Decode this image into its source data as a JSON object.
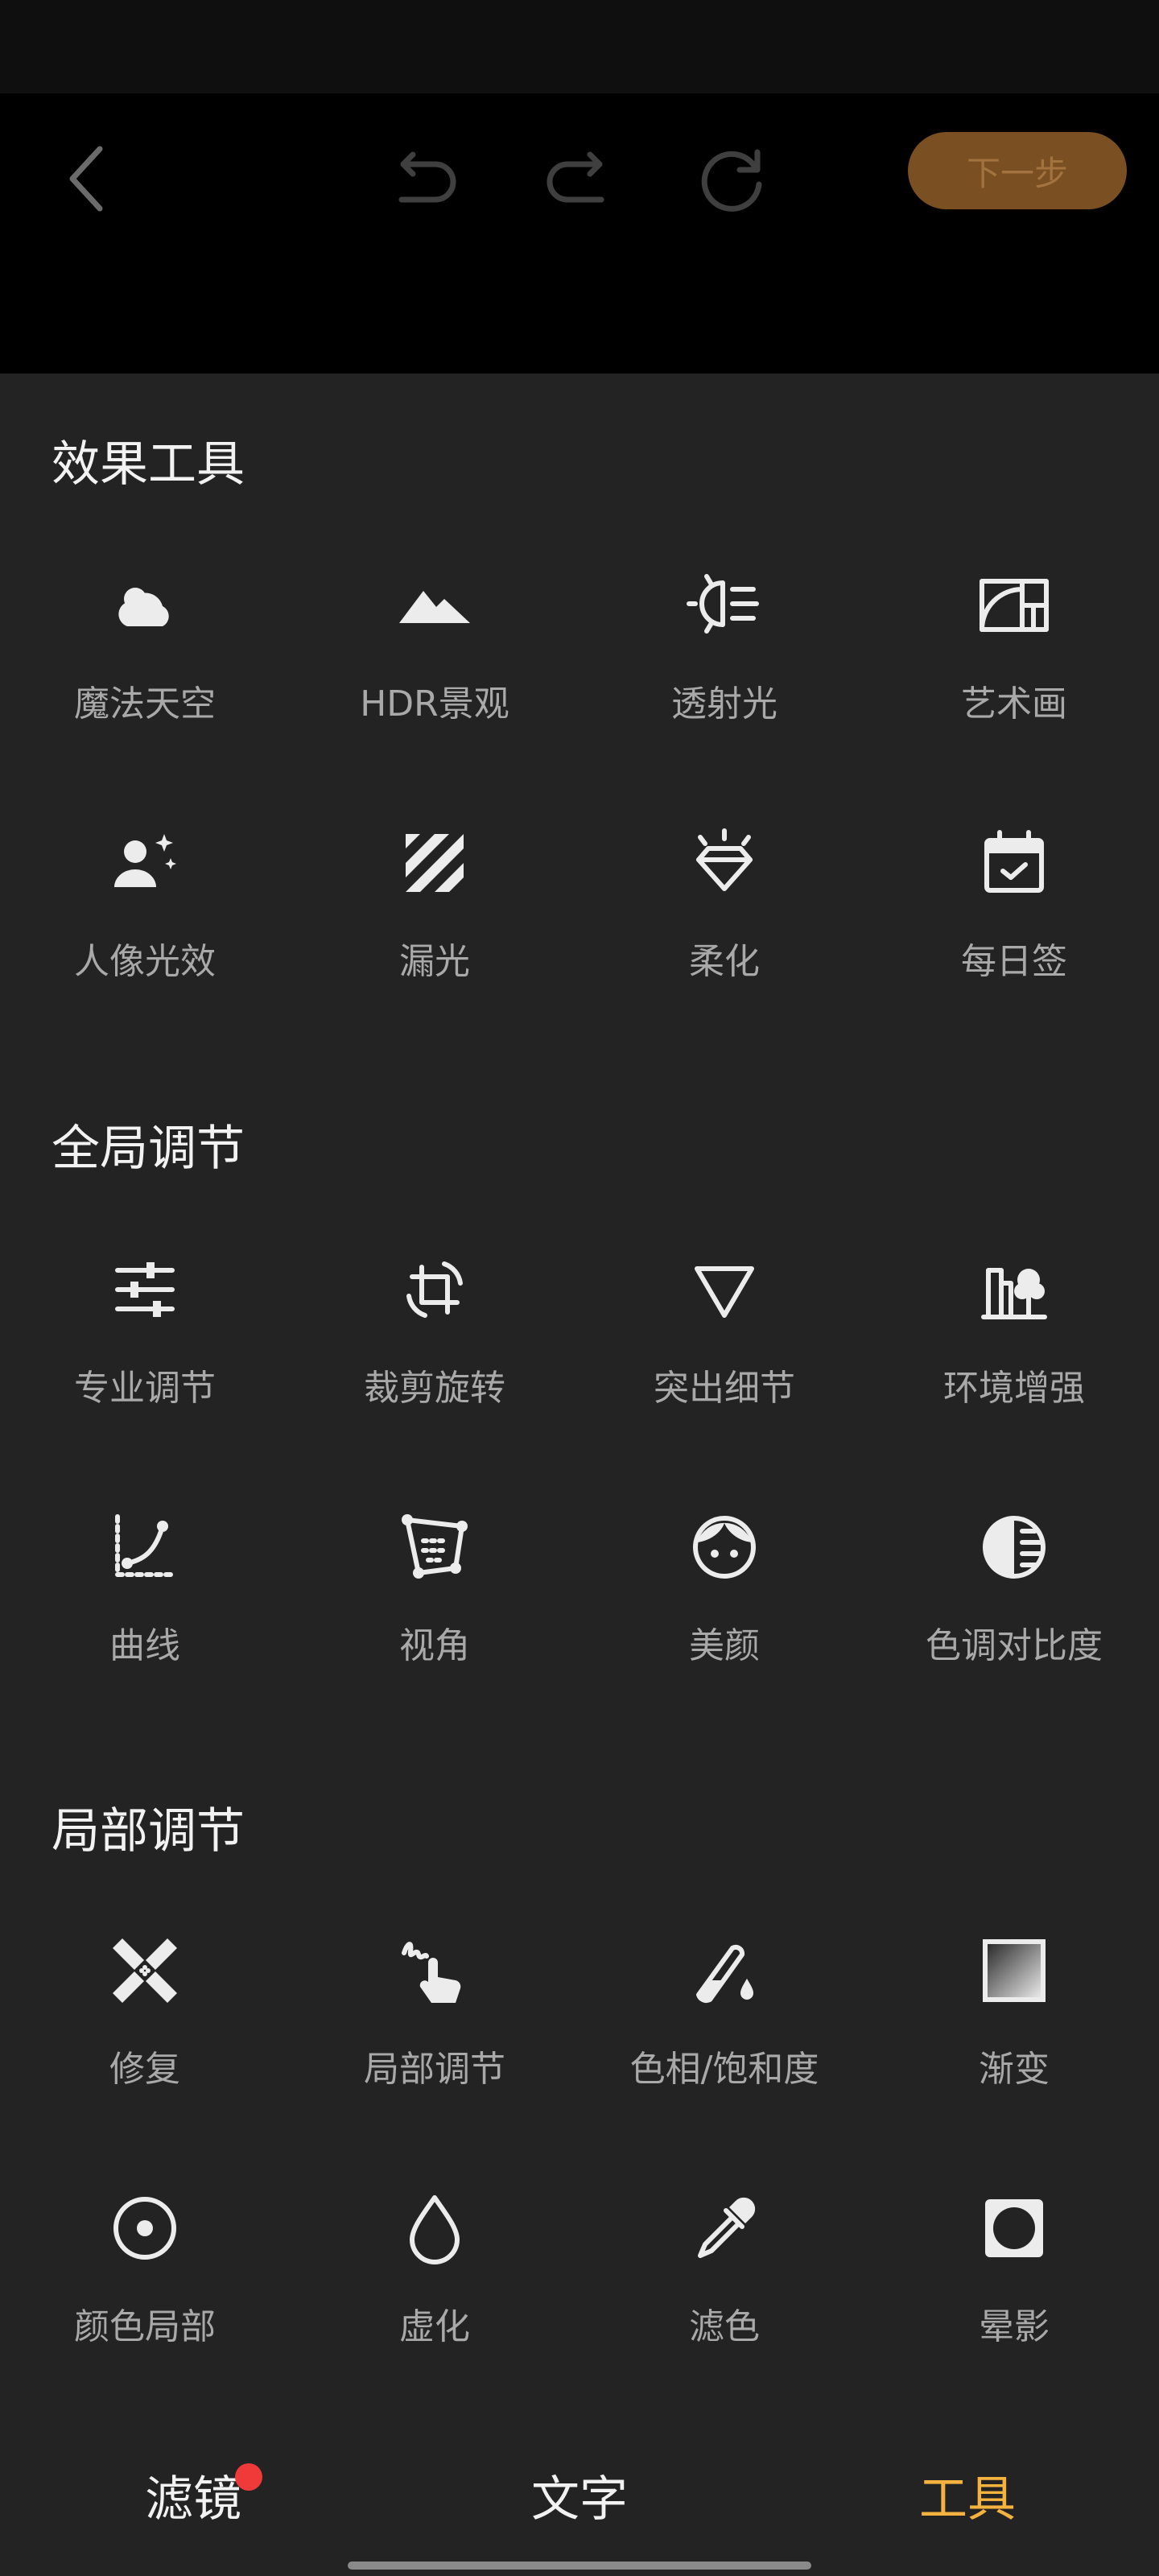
{
  "toolbar": {
    "next_label": "下一步"
  },
  "sections": [
    {
      "title": "效果工具"
    },
    {
      "title": "全局调节"
    },
    {
      "title": "局部调节"
    }
  ],
  "tools": {
    "magic_sky": "魔法天空",
    "hdr": "HDR景观",
    "light_rays": "透射光",
    "art_painting": "艺术画",
    "portrait_light": "人像光效",
    "light_leak": "漏光",
    "soften": "柔化",
    "daily_sign": "每日签",
    "pro_adjust": "专业调节",
    "crop_rotate": "裁剪旋转",
    "detail": "突出细节",
    "ambience": "环境增强",
    "curves": "曲线",
    "perspective": "视角",
    "beauty": "美颜",
    "tone_contrast": "色调对比度",
    "repair": "修复",
    "local_adjust": "局部调节",
    "hue_saturation": "色相/饱和度",
    "gradient": "渐变",
    "color_local": "颜色局部",
    "blur": "虚化",
    "color_filter": "滤色",
    "vignette": "晕影"
  },
  "bottom_nav": {
    "filter": "滤镜",
    "text": "文字",
    "tools": "工具",
    "active": "工具",
    "active_color": "#f4b23e",
    "badge_color": "#f03a3a"
  }
}
